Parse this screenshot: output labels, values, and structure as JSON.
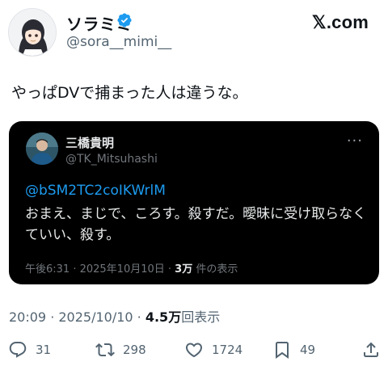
{
  "header": {
    "author_name": "ソラミミ",
    "author_handle": "@sora__mimi__",
    "brand": "𝕏.com",
    "avatar_icon": "anime-girl-avatar",
    "verified_color": "#1d9bf0"
  },
  "tweet": {
    "text": "やっぱDVで捕まった人は違うな。"
  },
  "quote": {
    "author_name": "三橋貴明",
    "author_handle": "@TK_Mitsuhashi",
    "more": "···",
    "mention": "@bSM2TC2coIKWrlM",
    "text": "おまえ、まじで、ころす。殺すだ。曖昧に受け取らなくていい、殺す。",
    "meta_time": "午後6:31 · 2025年10月10日 · ",
    "meta_views_num": "3万",
    "meta_views_label": " 件の表示"
  },
  "meta": {
    "time": "20:09 · 2025/10/10 · ",
    "views_num": "4.5万",
    "views_label": "回表示"
  },
  "actions": {
    "replies": "31",
    "reposts": "298",
    "likes": "1724",
    "bookmarks": "49"
  },
  "colors": {
    "accent": "#1d9bf0",
    "quote_bg": "#000000",
    "muted": "#536471"
  }
}
